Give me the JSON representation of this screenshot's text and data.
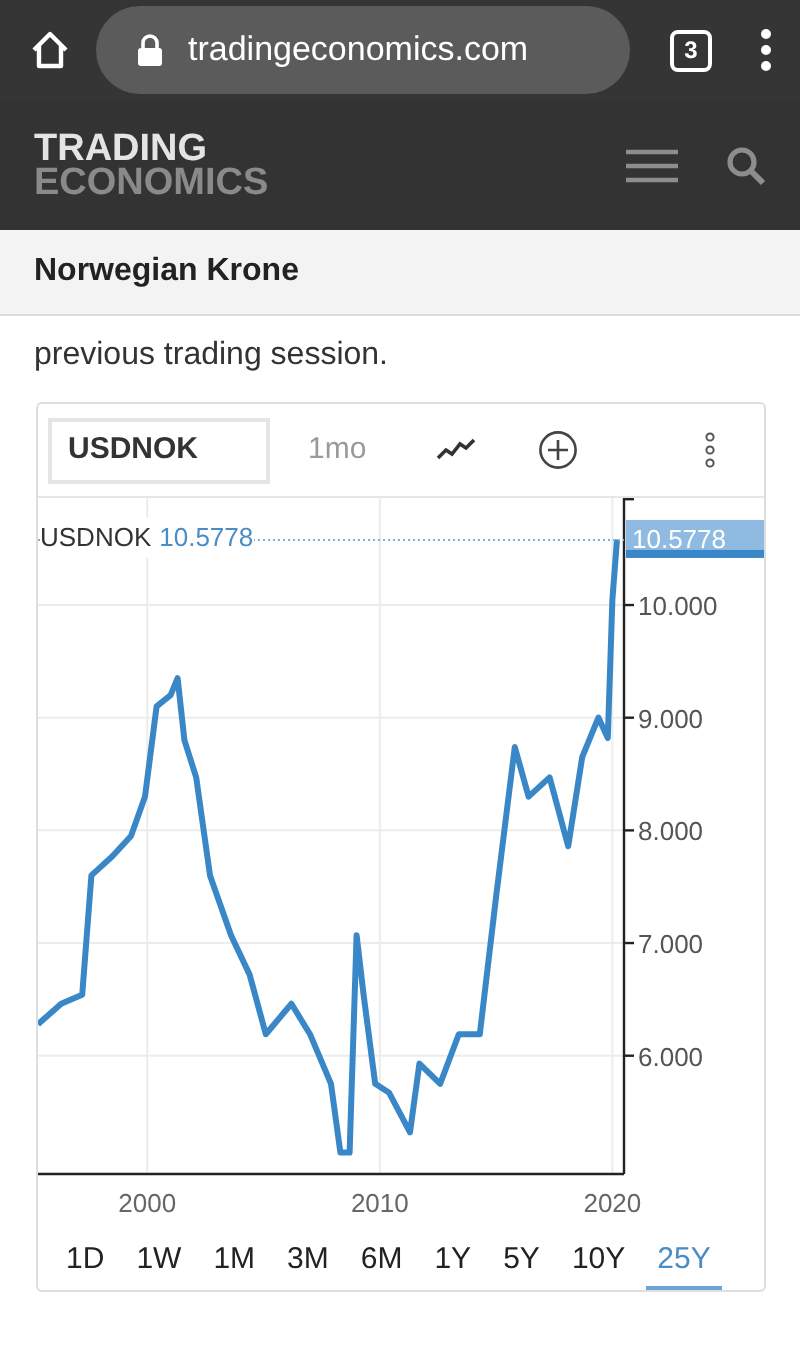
{
  "browser": {
    "url": "tradingeconomics.com",
    "tab_count": "3"
  },
  "site": {
    "logo_top": "TRADING",
    "logo_bottom": "ECONOMICS"
  },
  "page_title": "Norwegian Krone",
  "intro_tail": "previous trading session.",
  "chart_toolbar": {
    "symbol": "USDNOK",
    "interval": "1mo"
  },
  "chart_legend": {
    "symbol": "USDNOK",
    "value": "10.5778"
  },
  "chart_data": {
    "type": "line",
    "xlim": [
      1995.3,
      2020.5
    ],
    "ylim": [
      4.95,
      10.95
    ],
    "xticks": [
      2000,
      2010,
      2020
    ],
    "yticks": [
      {
        "value": 6,
        "label": "6.000"
      },
      {
        "value": 7,
        "label": "7.000"
      },
      {
        "value": 8,
        "label": "8.000"
      },
      {
        "value": 9,
        "label": "9.000"
      },
      {
        "value": 10,
        "label": "10.000"
      }
    ],
    "x": [
      1995.3,
      1996.3,
      1997.2,
      1997.6,
      1998.5,
      1999.3,
      1999.9,
      2000.4,
      2001.0,
      2001.3,
      2001.6,
      2002.1,
      2002.7,
      2003.6,
      2004.4,
      2005.1,
      2006.2,
      2007.0,
      2007.9,
      2008.3,
      2008.7,
      2009.0,
      2009.3,
      2009.8,
      2010.4,
      2011.3,
      2011.7,
      2012.6,
      2013.4,
      2014.3,
      2015.0,
      2015.8,
      2016.4,
      2017.3,
      2018.1,
      2018.7,
      2019.4,
      2019.8,
      2020.0,
      2020.2
    ],
    "series": [
      {
        "color": "#3a87c8",
        "values": [
          6.28,
          6.46,
          6.54,
          7.6,
          7.77,
          7.95,
          8.3,
          9.1,
          9.2,
          9.35,
          8.8,
          8.47,
          7.6,
          7.07,
          6.72,
          6.19,
          6.46,
          6.19,
          5.75,
          5.14,
          5.14,
          7.07,
          6.54,
          5.75,
          5.67,
          5.32,
          5.93,
          5.75,
          6.19,
          6.19,
          7.42,
          8.74,
          8.3,
          8.47,
          7.86,
          8.65,
          9.0,
          8.82,
          10.05,
          10.58
        ]
      }
    ],
    "grid": true,
    "ref_lines": [
      {
        "axis": "y",
        "value": 10.5778,
        "label": "10.5778"
      }
    ]
  },
  "ranges": [
    {
      "label": "1D",
      "selected": false
    },
    {
      "label": "1W",
      "selected": false
    },
    {
      "label": "1M",
      "selected": false
    },
    {
      "label": "3M",
      "selected": false
    },
    {
      "label": "6M",
      "selected": false
    },
    {
      "label": "1Y",
      "selected": false
    },
    {
      "label": "5Y",
      "selected": false
    },
    {
      "label": "10Y",
      "selected": false
    },
    {
      "label": "25Y",
      "selected": true
    }
  ]
}
